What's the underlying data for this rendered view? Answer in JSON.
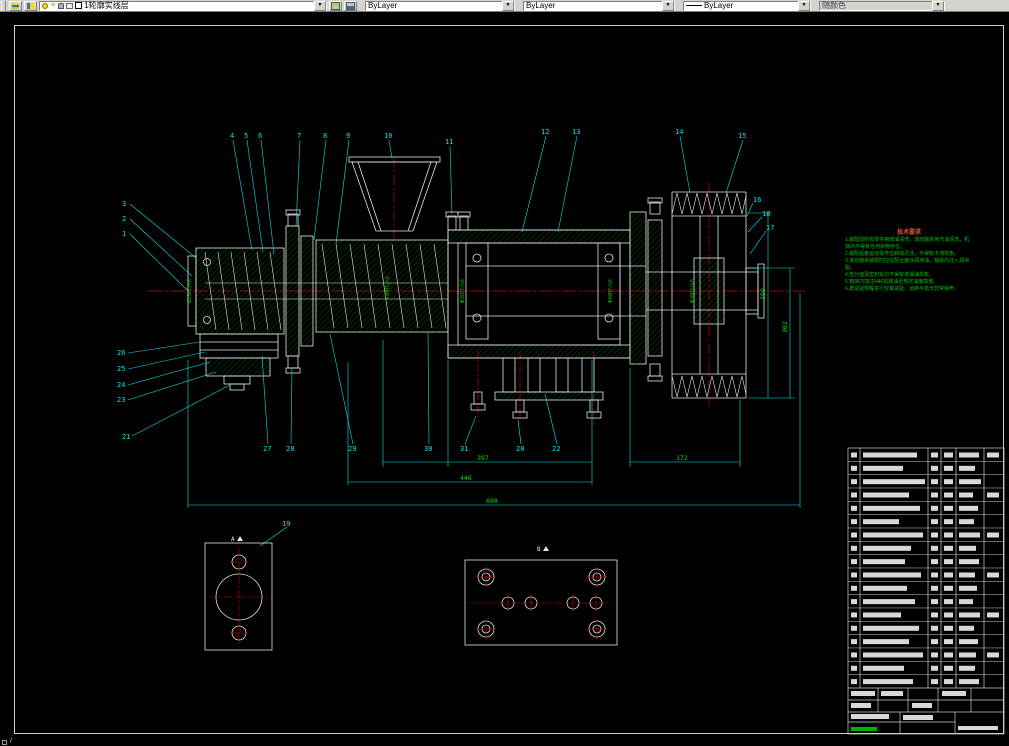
{
  "toolbar": {
    "layer_combo": {
      "value": "1轮廓实线层"
    },
    "color_combo": {
      "value": "ByLayer"
    },
    "linetype_combo": {
      "value": "ByLayer"
    },
    "lineweight_combo": {
      "value": "ByLayer"
    },
    "plotstyle_combo": {
      "value": "随颜色"
    }
  },
  "icons": {
    "dropdown_arrow": "▼",
    "freeze_sun": "☀"
  },
  "statusbar": {
    "prompt": "/"
  },
  "notes": {
    "title": "技术要求",
    "lines": [
      "1.装配前所有零件用煤油清洗，滚动轴承用汽油清洗，机体内不得有任何杂物存在。",
      "2.装配后各运动零件应转动灵活，不得有卡滞现象。",
      "3.滚动轴承装配时应在配合面涂润滑油，轴承内注入润滑脂。",
      "4.剖分面及密封处均不得有渗漏油现象。",
      "5.箱体内加注N46机械油至规定油面高度。",
      "6.按试验规程进行空载试验，运转平稳无异常噪声。"
    ]
  },
  "callouts": {
    "top": [
      "4",
      "5",
      "6",
      "7",
      "8",
      "9",
      "10",
      "11",
      "12",
      "13",
      "14",
      "15"
    ],
    "left": [
      "3",
      "2",
      "1"
    ],
    "left_lower": [
      "26",
      "25",
      "24",
      "23",
      "21"
    ],
    "bottom": [
      "27",
      "28",
      "29",
      "30",
      "31",
      "20",
      "22"
    ],
    "right": [
      "16",
      "18",
      "17"
    ],
    "view_a": "19"
  },
  "dimensions": {
    "d1": "397",
    "d2": "446",
    "d3": "698",
    "d4": "172",
    "d5": "350",
    "d6": "302"
  },
  "fits": [
    "Φ25H7/k6",
    "Φ30H7/k6",
    "Φ35H7/k6",
    "Φ40H7/k6",
    "Φ28H7/k6"
  ],
  "view_labels": {
    "a": "A",
    "b": "B"
  }
}
